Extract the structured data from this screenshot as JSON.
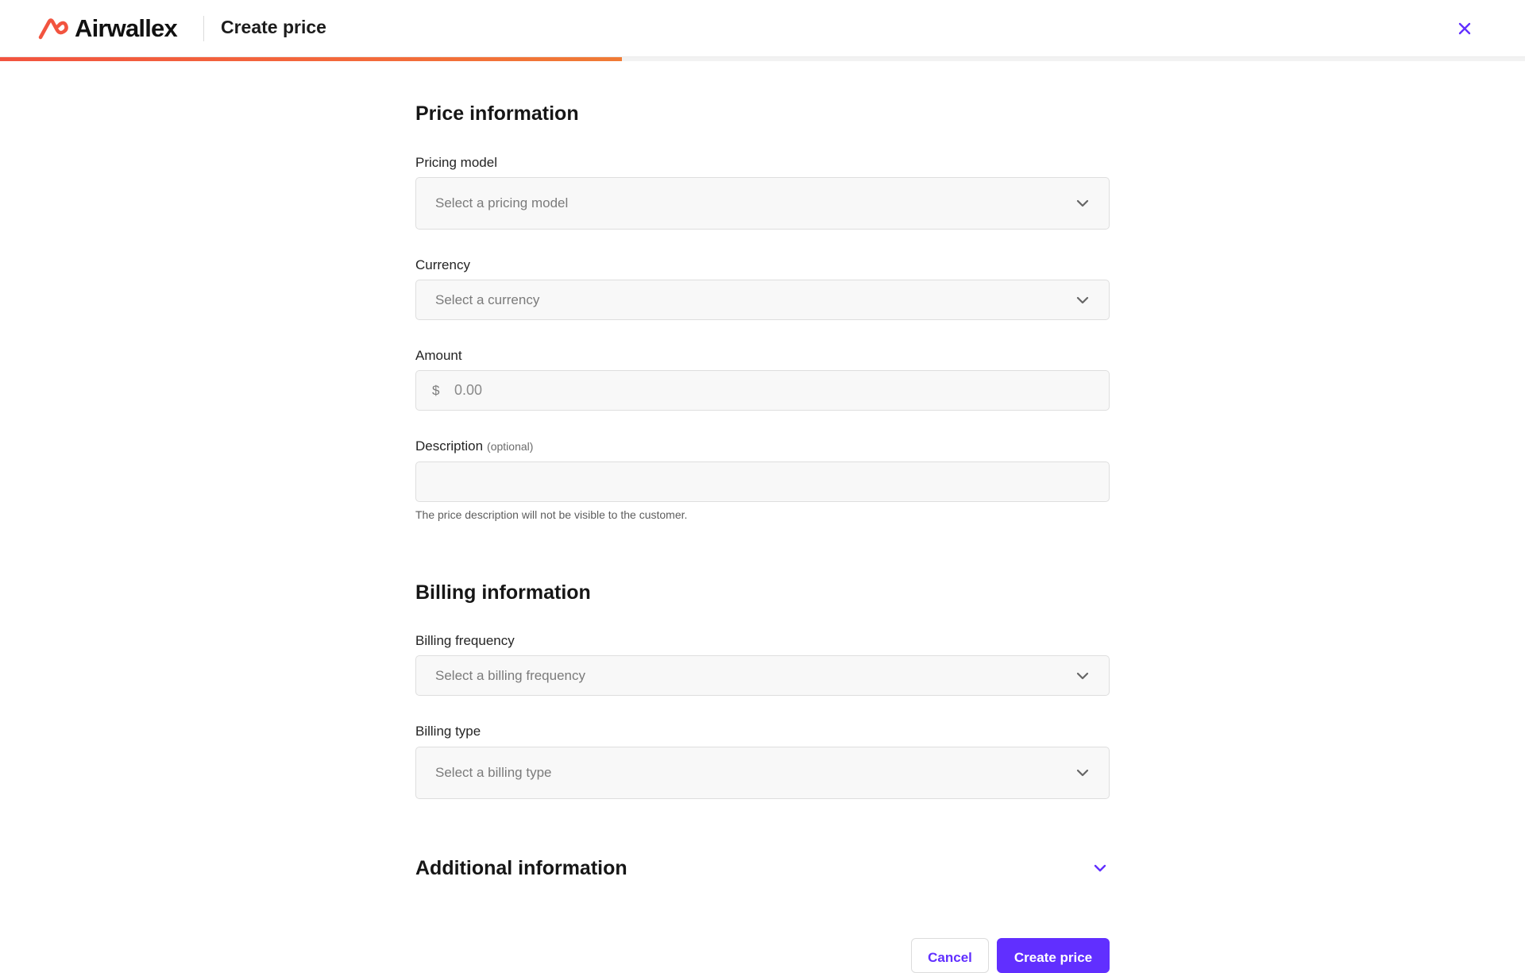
{
  "app": {
    "brand": "Airwallex",
    "page_title": "Create price"
  },
  "progress": {
    "fraction": 0.408
  },
  "colors": {
    "brand_orange": "#f2543f",
    "accent_purple": "#612fff"
  },
  "icons": {
    "close": "close-icon",
    "chevron": "chevron-down-icon",
    "logo": "airwallex-logo-icon"
  },
  "price_section": {
    "title": "Price information",
    "pricing_model": {
      "label": "Pricing model",
      "placeholder": "Select a pricing model"
    },
    "currency": {
      "label": "Currency",
      "placeholder": "Select a currency"
    },
    "amount": {
      "label": "Amount",
      "prefix": "$",
      "placeholder": "0.00"
    },
    "description": {
      "label": "Description",
      "optional_tag": "(optional)",
      "value": "",
      "help_text": "The price description will not be visible to the customer."
    }
  },
  "billing_section": {
    "title": "Billing information",
    "billing_frequency": {
      "label": "Billing frequency",
      "placeholder": "Select a billing frequency"
    },
    "billing_type": {
      "label": "Billing type",
      "placeholder": "Select a billing type"
    }
  },
  "additional_section": {
    "title": "Additional information",
    "expanded": false
  },
  "footer": {
    "cancel_label": "Cancel",
    "submit_label": "Create price"
  }
}
